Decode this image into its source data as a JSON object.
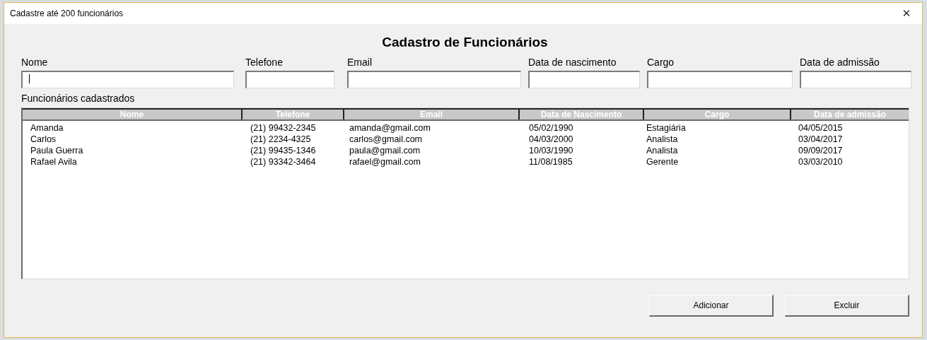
{
  "window": {
    "title": "Cadastre até 200 funcionários",
    "close": "✕"
  },
  "heading": "Cadastro de Funcionários",
  "form": {
    "fields": [
      {
        "label": "Nome",
        "focused": true
      },
      {
        "label": "Telefone",
        "focused": false
      },
      {
        "label": "Email",
        "focused": false
      },
      {
        "label": "Data de nascimento",
        "focused": false
      },
      {
        "label": "Cargo",
        "focused": false
      },
      {
        "label": "Data de admissão",
        "focused": false
      }
    ]
  },
  "table": {
    "caption": "Funcionários cadastrados",
    "columns": [
      "Nome",
      "Telefone",
      "Email",
      "Data de Nascimento",
      "Cargo",
      "Data de admissão"
    ],
    "rows": [
      [
        "Amanda",
        "(21) 99432-2345",
        "amanda@gmail.com",
        "05/02/1990",
        "Estagiária",
        "04/05/2015"
      ],
      [
        "Carlos",
        "(21) 2234-4325",
        "carlos@gmail.com",
        "04/03/2000",
        "Analista",
        "03/04/2017"
      ],
      [
        "Paula Guerra",
        "(21) 99435-1346",
        "paula@gmail.com",
        "10/03/1990",
        "Analista",
        "09/09/2017"
      ],
      [
        "Rafael Avila",
        "(21) 93342-3464",
        "rafael@gmail.com",
        "11/08/1985",
        "Gerente",
        "03/03/2010"
      ]
    ]
  },
  "buttons": [
    "Adicionar",
    "Excluir"
  ]
}
